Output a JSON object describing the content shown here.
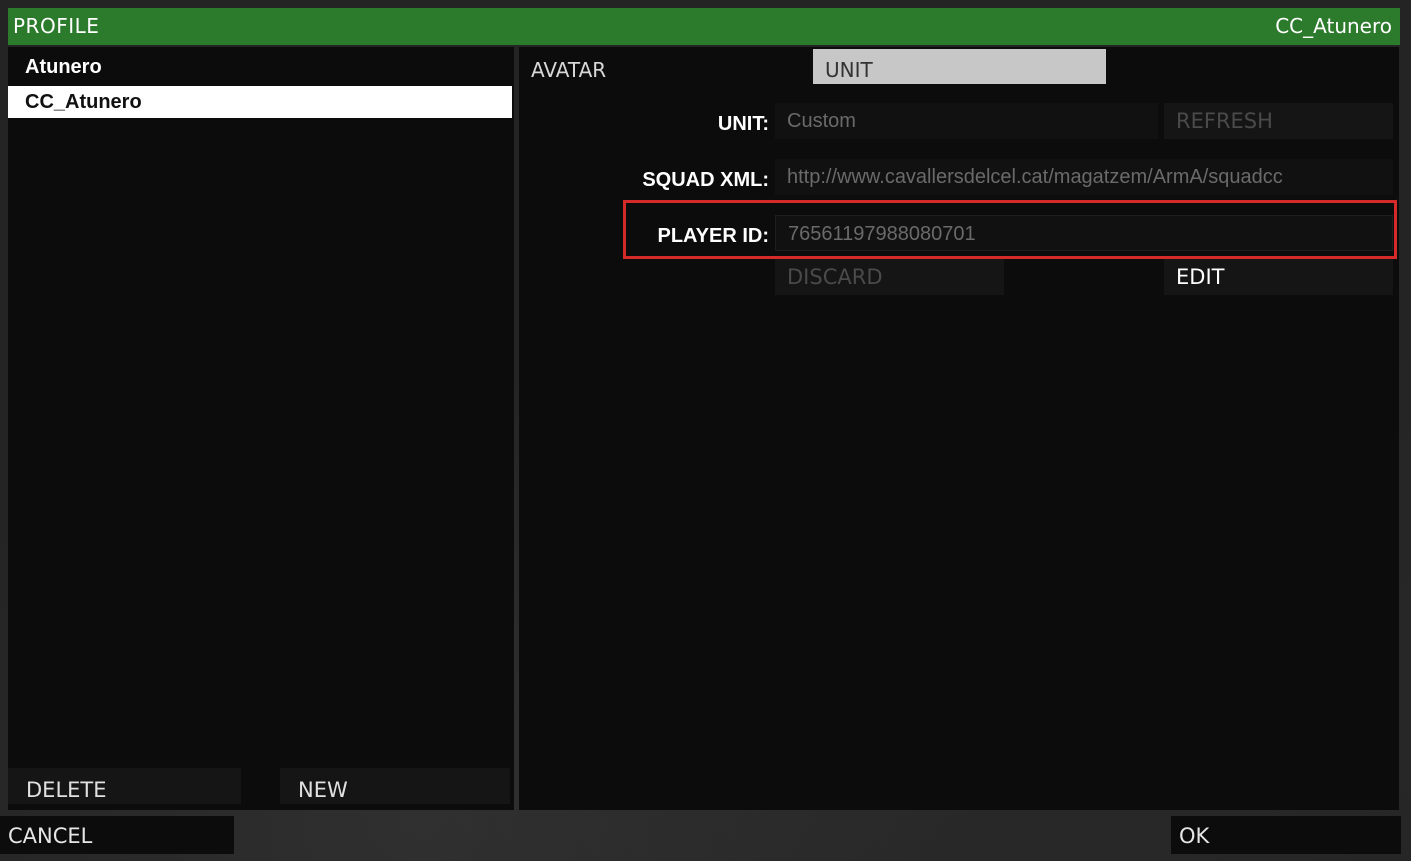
{
  "window": {
    "title": "PROFILE",
    "current_profile": "CC_Atunero"
  },
  "profiles": [
    {
      "name": "Atunero",
      "selected": false
    },
    {
      "name": "CC_Atunero",
      "selected": true
    }
  ],
  "left_buttons": {
    "delete": "DELETE",
    "new": "NEW"
  },
  "tabs": {
    "avatar": "AVATAR",
    "unit": "UNIT",
    "active": "UNIT"
  },
  "unit_form": {
    "unit_label": "UNIT:",
    "unit_value": "Custom",
    "refresh": "REFRESH",
    "squad_label": "SQUAD XML:",
    "squad_value": "http://www.cavallersdelcel.cat/magatzem/ArmA/squadcc",
    "player_label": "PLAYER ID:",
    "player_value": "76561197988080701",
    "discard": "DISCARD",
    "edit": "EDIT"
  },
  "footer": {
    "cancel": "CANCEL",
    "ok": "OK"
  },
  "colors": {
    "title_bar": "#2c7a2c",
    "highlight": "#d42a2a",
    "tab_active": "#c7c7c7"
  }
}
